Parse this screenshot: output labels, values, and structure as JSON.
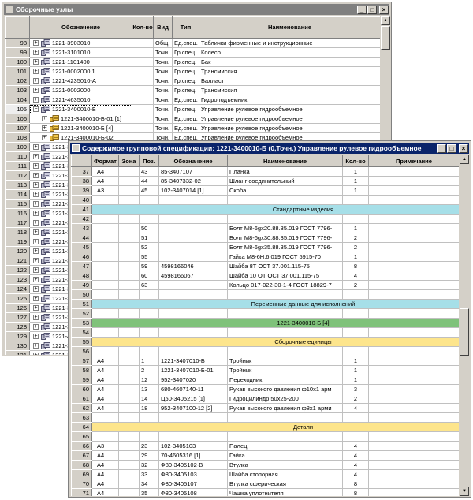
{
  "window1": {
    "title": "Сборочные узлы",
    "headers": [
      "",
      "Обозначение",
      "Кол-во",
      "Вид",
      "Тип",
      "Наименование"
    ],
    "rows": [
      {
        "num": "98",
        "designation": "1221-3903010",
        "qty": "",
        "kind": "Общ.",
        "type": "Ед.спец.",
        "name": "Таблички фирменные и инструкционные",
        "expander": "+",
        "level": 0
      },
      {
        "num": "99",
        "designation": "1221-3101010",
        "qty": "",
        "kind": "Точн.",
        "type": "Гр.спец.",
        "name": "Колесо",
        "expander": "+",
        "level": 0
      },
      {
        "num": "100",
        "designation": "1221-1101400",
        "qty": "",
        "kind": "Точн.",
        "type": "Гр.спец.",
        "name": "Бак",
        "expander": "+",
        "level": 0
      },
      {
        "num": "101",
        "designation": "1221-0002000 1",
        "qty": "",
        "kind": "Точн.",
        "type": "Гр.спец.",
        "name": "Трансмиссия",
        "expander": "+",
        "level": 0
      },
      {
        "num": "102",
        "designation": "1221-4235010-А",
        "qty": "",
        "kind": "Точн.",
        "type": "Гр.спец.",
        "name": "Балласт",
        "expander": "+",
        "level": 0
      },
      {
        "num": "103",
        "designation": "1221-0002000",
        "qty": "",
        "kind": "Точн.",
        "type": "Гр.спец.",
        "name": "Трансмиссия",
        "expander": "+",
        "level": 0
      },
      {
        "num": "104",
        "designation": "1221-4635010",
        "qty": "",
        "kind": "Точн.",
        "type": "Ед.спец.",
        "name": "Гидроподъемник",
        "expander": "+",
        "level": 0
      },
      {
        "num": "105",
        "designation": "1221-3400010-Б",
        "qty": "",
        "kind": "Точн.",
        "type": "Гр.спец.",
        "name": "Управление рулевое гидрообъемное",
        "expander": "−",
        "level": 0,
        "selected": true
      },
      {
        "num": "106",
        "designation": "1221-3400010-Б-01 [1]",
        "qty": "",
        "kind": "Точн.",
        "type": "Ед.спец.",
        "name": "Управление рулевое гидрообъемное",
        "expander": "+",
        "level": 1
      },
      {
        "num": "107",
        "designation": "1221-3400010-Б [4]",
        "qty": "",
        "kind": "Точн.",
        "type": "Ед.спец.",
        "name": "Управление рулевое гидрообъемное",
        "expander": "+",
        "level": 1
      },
      {
        "num": "108",
        "designation": "1221-3400010-Б-02",
        "qty": "",
        "kind": "Точн.",
        "type": "Ед.спец.",
        "name": "Управление рулевое гидрообъемное",
        "expander": "+",
        "level": 1
      },
      {
        "num": "109",
        "designation": "1221-3",
        "qty": "",
        "kind": "",
        "type": "",
        "name": "",
        "expander": "+",
        "level": 0
      },
      {
        "num": "110",
        "designation": "1221-3",
        "qty": "",
        "kind": "",
        "type": "",
        "name": "",
        "expander": "+",
        "level": 0
      },
      {
        "num": "111",
        "designation": "1221-3",
        "qty": "",
        "kind": "",
        "type": "",
        "name": "",
        "expander": "+",
        "level": 0
      },
      {
        "num": "112",
        "designation": "1221-3",
        "qty": "",
        "kind": "",
        "type": "",
        "name": "",
        "expander": "+",
        "level": 0
      },
      {
        "num": "113",
        "designation": "1221-3",
        "qty": "",
        "kind": "",
        "type": "",
        "name": "",
        "expander": "+",
        "level": 0
      },
      {
        "num": "114",
        "designation": "1221-3",
        "qty": "",
        "kind": "",
        "type": "",
        "name": "",
        "expander": "+",
        "level": 0
      },
      {
        "num": "115",
        "designation": "1221-3",
        "qty": "",
        "kind": "",
        "type": "",
        "name": "",
        "expander": "+",
        "level": 0
      },
      {
        "num": "116",
        "designation": "1221-3",
        "qty": "",
        "kind": "",
        "type": "",
        "name": "",
        "expander": "+",
        "level": 0
      },
      {
        "num": "117",
        "designation": "1221-3",
        "qty": "",
        "kind": "",
        "type": "",
        "name": "",
        "expander": "+",
        "level": 0
      },
      {
        "num": "118",
        "designation": "1221-3",
        "qty": "",
        "kind": "",
        "type": "",
        "name": "",
        "expander": "+",
        "level": 0
      },
      {
        "num": "119",
        "designation": "1221-3",
        "qty": "",
        "kind": "",
        "type": "",
        "name": "",
        "expander": "+",
        "level": 0
      },
      {
        "num": "120",
        "designation": "1221-3",
        "qty": "",
        "kind": "",
        "type": "",
        "name": "",
        "expander": "+",
        "level": 0
      },
      {
        "num": "121",
        "designation": "1221-3",
        "qty": "",
        "kind": "",
        "type": "",
        "name": "",
        "expander": "+",
        "level": 0
      },
      {
        "num": "122",
        "designation": "1221-3",
        "qty": "",
        "kind": "",
        "type": "",
        "name": "",
        "expander": "+",
        "level": 0
      },
      {
        "num": "123",
        "designation": "1221-3",
        "qty": "",
        "kind": "",
        "type": "",
        "name": "",
        "expander": "+",
        "level": 0
      },
      {
        "num": "124",
        "designation": "1221-3",
        "qty": "",
        "kind": "",
        "type": "",
        "name": "",
        "expander": "+",
        "level": 0
      },
      {
        "num": "125",
        "designation": "1221-3",
        "qty": "",
        "kind": "",
        "type": "",
        "name": "",
        "expander": "+",
        "level": 0
      },
      {
        "num": "126",
        "designation": "1221-3",
        "qty": "",
        "kind": "",
        "type": "",
        "name": "",
        "expander": "+",
        "level": 0
      },
      {
        "num": "127",
        "designation": "1221-3",
        "qty": "",
        "kind": "",
        "type": "",
        "name": "",
        "expander": "+",
        "level": 0
      },
      {
        "num": "128",
        "designation": "1221-3",
        "qty": "",
        "kind": "",
        "type": "",
        "name": "",
        "expander": "+",
        "level": 0
      },
      {
        "num": "129",
        "designation": "1221-4",
        "qty": "",
        "kind": "",
        "type": "",
        "name": "",
        "expander": "+",
        "level": 0
      },
      {
        "num": "130",
        "designation": "1221-3",
        "qty": "",
        "kind": "",
        "type": "",
        "name": "",
        "expander": "+",
        "level": 0
      },
      {
        "num": "131",
        "designation": "1221-3",
        "qty": "",
        "kind": "",
        "type": "",
        "name": "",
        "expander": "+",
        "level": 0
      }
    ]
  },
  "window2": {
    "title": "Содержимое групповой спецификации: 1221-3400010-Б (0,Точн.)  Управление рулевое гидрообъемное",
    "headers": [
      "",
      "Формат",
      "Зона",
      "Поз.",
      "Обозначение",
      "Наименование",
      "Кол-во",
      "Примечание"
    ],
    "rows": [
      {
        "num": "37",
        "format": "А4",
        "zone": "",
        "pos": "43",
        "designation": "85-3407107",
        "name": "Планка",
        "qty": "1",
        "note": ""
      },
      {
        "num": "38",
        "format": "А4",
        "zone": "",
        "pos": "44",
        "designation": "85-3407332-02",
        "name": "Шланг соединительный",
        "qty": "1",
        "note": ""
      },
      {
        "num": "39",
        "format": "А3",
        "zone": "",
        "pos": "45",
        "designation": "102-3407014 [1]",
        "name": "Скоба",
        "qty": "1",
        "note": ""
      },
      {
        "num": "40",
        "format": "",
        "zone": "",
        "pos": "",
        "designation": "",
        "name": "",
        "qty": "",
        "note": ""
      },
      {
        "num": "41",
        "section": "Стандартные изделия",
        "color": "blue"
      },
      {
        "num": "42",
        "format": "",
        "zone": "",
        "pos": "",
        "designation": "",
        "name": "",
        "qty": "",
        "note": ""
      },
      {
        "num": "43",
        "format": "",
        "zone": "",
        "pos": "50",
        "designation": "",
        "name": "Болт М8-6gx20.88.35.019 ГОСТ 7796-",
        "qty": "1",
        "note": ""
      },
      {
        "num": "44",
        "format": "",
        "zone": "",
        "pos": "51",
        "designation": "",
        "name": "Болт М8-6gx30.88.35.019 ГОСТ 7796-",
        "qty": "2",
        "note": ""
      },
      {
        "num": "45",
        "format": "",
        "zone": "",
        "pos": "52",
        "designation": "",
        "name": "Болт М8-6gx35.88.35.019 ГОСТ 7796-",
        "qty": "2",
        "note": ""
      },
      {
        "num": "46",
        "format": "",
        "zone": "",
        "pos": "55",
        "designation": "",
        "name": "Гайка М8-6Н.6.019 ГОСТ 5915-70",
        "qty": "1",
        "note": ""
      },
      {
        "num": "47",
        "format": "",
        "zone": "",
        "pos": "59",
        "designation": "4598166046",
        "name": "Шайба 8Т ОСТ 37.001.115-75",
        "qty": "8",
        "note": ""
      },
      {
        "num": "48",
        "format": "",
        "zone": "",
        "pos": "60",
        "designation": "4598166067",
        "name": "Шайба 10 ОТ ОСТ 37.001.115-75",
        "qty": "4",
        "note": ""
      },
      {
        "num": "49",
        "format": "",
        "zone": "",
        "pos": "63",
        "designation": "",
        "name": "Кольцо 017-022-30-1-4 ГОСТ 18829-7",
        "qty": "2",
        "note": ""
      },
      {
        "num": "50",
        "format": "",
        "zone": "",
        "pos": "",
        "designation": "",
        "name": "",
        "qty": "",
        "note": ""
      },
      {
        "num": "51",
        "section": "Переменные данные для исполнений",
        "color": "blue"
      },
      {
        "num": "52",
        "format": "",
        "zone": "",
        "pos": "",
        "designation": "",
        "name": "",
        "qty": "",
        "note": ""
      },
      {
        "num": "53",
        "section": "1221-3400010-Б [4]",
        "color": "green"
      },
      {
        "num": "54",
        "format": "",
        "zone": "",
        "pos": "",
        "designation": "",
        "name": "",
        "qty": "",
        "note": ""
      },
      {
        "num": "55",
        "section": "Сборочные единицы",
        "color": "yellow"
      },
      {
        "num": "56",
        "format": "",
        "zone": "",
        "pos": "",
        "designation": "",
        "name": "",
        "qty": "",
        "note": ""
      },
      {
        "num": "57",
        "format": "А4",
        "zone": "",
        "pos": "1",
        "designation": "1221-3407010-Б",
        "name": "Тройник",
        "qty": "1",
        "note": ""
      },
      {
        "num": "58",
        "format": "А4",
        "zone": "",
        "pos": "2",
        "designation": "1221-3407010-Б-01",
        "name": "Тройник",
        "qty": "1",
        "note": ""
      },
      {
        "num": "59",
        "format": "А4",
        "zone": "",
        "pos": "12",
        "designation": "952-3407020",
        "name": "Переходник",
        "qty": "1",
        "note": ""
      },
      {
        "num": "60",
        "format": "А4",
        "zone": "",
        "pos": "13",
        "designation": "680-4607140-11",
        "name": "Рукав высокого давления ф10х1 арм",
        "qty": "3",
        "note": ""
      },
      {
        "num": "61",
        "format": "А4",
        "zone": "",
        "pos": "14",
        "designation": "Ц50-3405215 [1]",
        "name": "Гидроцилиндр 50х25-200",
        "qty": "2",
        "note": ""
      },
      {
        "num": "62",
        "format": "А4",
        "zone": "",
        "pos": "18",
        "designation": "952-3407100-12 [2]",
        "name": "Рукав высокого давления ф8х1 арми",
        "qty": "4",
        "note": ""
      },
      {
        "num": "63",
        "format": "",
        "zone": "",
        "pos": "",
        "designation": "",
        "name": "",
        "qty": "",
        "note": ""
      },
      {
        "num": "64",
        "section": "Детали",
        "color": "yellow"
      },
      {
        "num": "65",
        "format": "",
        "zone": "",
        "pos": "",
        "designation": "",
        "name": "",
        "qty": "",
        "note": ""
      },
      {
        "num": "66",
        "format": "А3",
        "zone": "",
        "pos": "23",
        "designation": "102-3405103",
        "name": "Палец",
        "qty": "4",
        "note": ""
      },
      {
        "num": "67",
        "format": "А4",
        "zone": "",
        "pos": "29",
        "designation": "70-4605316 [1]",
        "name": "Гайка",
        "qty": "4",
        "note": ""
      },
      {
        "num": "68",
        "format": "А4",
        "zone": "",
        "pos": "32",
        "designation": "Ф80-3405102-В",
        "name": "Втулка",
        "qty": "4",
        "note": ""
      },
      {
        "num": "69",
        "format": "А4",
        "zone": "",
        "pos": "33",
        "designation": "Ф80-3405103",
        "name": "Шайба стопорная",
        "qty": "4",
        "note": ""
      },
      {
        "num": "70",
        "format": "А4",
        "zone": "",
        "pos": "34",
        "designation": "Ф80-3405107",
        "name": "Втулка сферическая",
        "qty": "8",
        "note": ""
      },
      {
        "num": "71",
        "format": "А4",
        "zone": "",
        "pos": "35",
        "designation": "Ф80-3405108",
        "name": "Чашка уплотнителя",
        "qty": "8",
        "note": ""
      }
    ]
  },
  "colors": {
    "section_blue": "#a6dfe8",
    "section_green": "#7fc27a",
    "section_yellow": "#fde58c",
    "title_active": "#0a246a",
    "title_inactive": "#808080"
  },
  "icons": {
    "window": "table-icon",
    "row": "assembly-icon",
    "expander": "plus-minus-icon"
  },
  "buttons": {
    "minimize": "_",
    "maximize": "□",
    "close": "×"
  }
}
